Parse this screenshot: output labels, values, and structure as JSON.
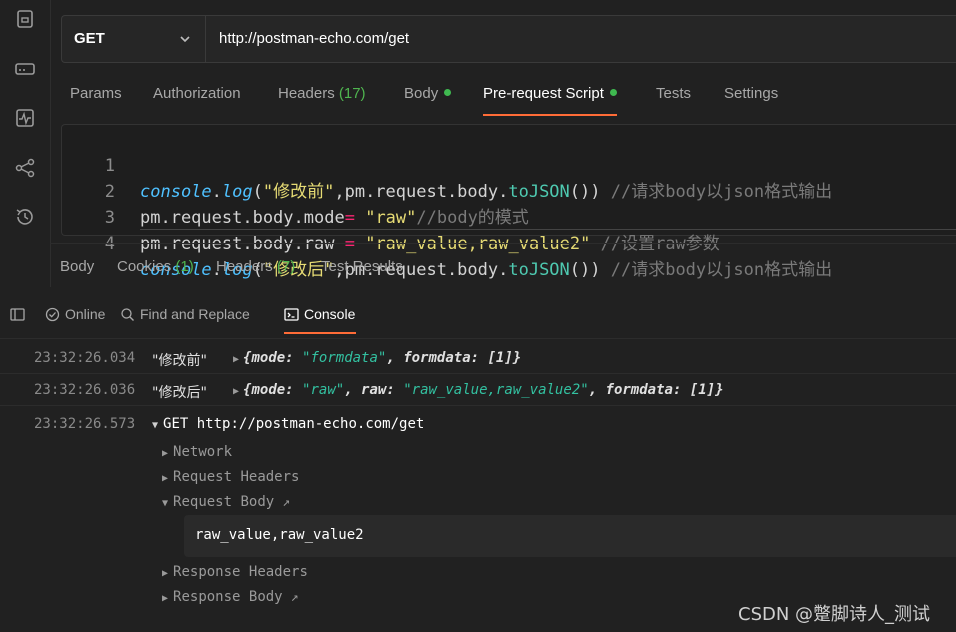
{
  "request": {
    "method": "GET",
    "url": "http://postman-echo.com/get"
  },
  "request_tabs": [
    {
      "label": "Params"
    },
    {
      "label": "Authorization"
    },
    {
      "label": "Headers",
      "count": "(17)"
    },
    {
      "label": "Body"
    },
    {
      "label": "Pre-request Script"
    },
    {
      "label": "Tests"
    },
    {
      "label": "Settings"
    }
  ],
  "editor": {
    "lines": [
      {
        "no": "1",
        "p1": "console",
        "p2": ".",
        "p3": "log",
        "p4": "(",
        "p5": "\"修改前\"",
        "p6": ",pm.request.body.",
        "p7": "toJSON",
        "p8": "()) ",
        "p9": "//请求body以json格式输出"
      },
      {
        "no": "2",
        "p1": "pm.request.body.mode",
        "p2": "=",
        "p3": " ",
        "p4": "\"raw\"",
        "p5": "//body的模式"
      },
      {
        "no": "3",
        "p1": "pm.request.body.raw ",
        "p2": "=",
        "p3": " ",
        "p4": "\"raw_value,raw_value2\"",
        "p5": " //设置raw参数"
      },
      {
        "no": "4",
        "p1": "console",
        "p2": ".",
        "p3": "log",
        "p4": "(",
        "p5": "\"修改后\"",
        "p6": ",pm.request.body.",
        "p7": "toJSON",
        "p8": "()) ",
        "p9": "//请求body以json格式输出"
      }
    ]
  },
  "response_tabs": [
    {
      "label": "Body"
    },
    {
      "label": "Cookies",
      "count": "(1)"
    },
    {
      "label": "Headers",
      "count": "(7)"
    },
    {
      "label": "Test Results"
    }
  ],
  "console_bar": {
    "online": "Online",
    "find_replace": "Find and Replace",
    "console": "Console"
  },
  "logs": [
    {
      "time": "23:32:26.034",
      "label": "\"修改前\"",
      "a": "{mode: ",
      "b": "\"formdata\"",
      "c": ", formdata: [1]}"
    },
    {
      "time": "23:32:26.036",
      "label": "\"修改后\"",
      "a": "{mode: ",
      "b": "\"raw\"",
      "c": ", raw: ",
      "d": "\"raw_value,raw_value2\"",
      "e": ", formdata: [1]}"
    }
  ],
  "request_log": {
    "time": "23:32:26.573",
    "title": "GET http://postman-echo.com/get",
    "network": "Network",
    "request_headers": "Request Headers",
    "request_body": "Request Body",
    "body_value": "raw_value,raw_value2",
    "response_headers": "Response Headers",
    "response_body": "Response Body"
  },
  "watermark": "CSDN @蹩脚诗人_测试",
  "colors": {
    "accent": "#ff6c37",
    "status_dot": "#3fb950",
    "count": "#4fb54f"
  }
}
